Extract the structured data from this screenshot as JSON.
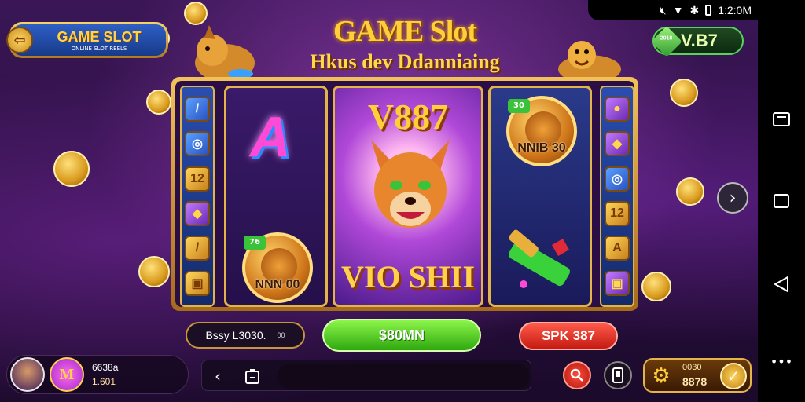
{
  "status_bar": {
    "time": "1:2:0M"
  },
  "logo": {
    "title": "GAME SLOT",
    "tagline": "ONLINE SLOT REELS"
  },
  "header": {
    "title": "GAME Slot",
    "subtitle": "Hkus dev Ddanniaing"
  },
  "balance": {
    "value": "V.B7",
    "gem_label": "2018"
  },
  "reels": {
    "left_symbol": "A",
    "left_badge": {
      "tag": "76",
      "label": "NNN 00"
    },
    "middle_top": "V887",
    "middle_bottom": "VIO SHII",
    "right_badge": {
      "tag": "30",
      "label": "NNIB 30"
    }
  },
  "side_symbols_left": [
    "/",
    "◎",
    "12",
    "◆",
    "/",
    "▣"
  ],
  "side_symbols_right": [
    "●",
    "◆",
    "◎",
    "12",
    "A",
    "▣"
  ],
  "controls": {
    "bet_label": "Bssy L3030.",
    "bet_small": "00",
    "spin_label": "$80MN",
    "red_label": "SPK 387"
  },
  "user": {
    "name": "6638a",
    "level": "1.601"
  },
  "coins": {
    "label": "0030",
    "value": "8878"
  },
  "icons": {
    "back": "back-icon",
    "app": "app-icon",
    "search": "search-icon",
    "phone": "phone-icon",
    "gear": "gear-icon",
    "check": "check-icon",
    "next": "chevron-right-icon"
  },
  "colors": {
    "accent_gold": "#ffcf3a",
    "spin_green": "#2fa80f",
    "red": "#c41a12",
    "bg": "#2a0f40"
  }
}
